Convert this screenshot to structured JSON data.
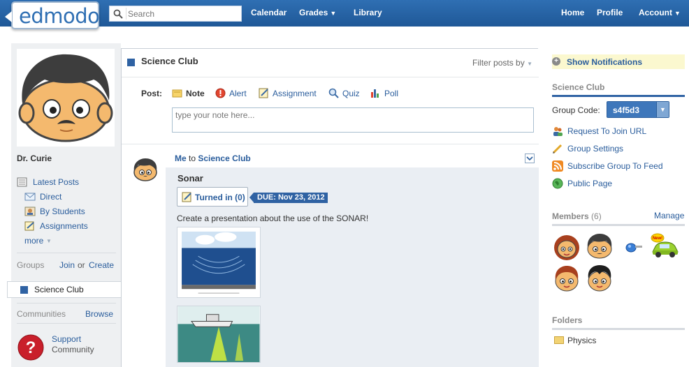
{
  "header": {
    "logo": "edmodo",
    "search_placeholder": "Search",
    "nav_left": [
      {
        "label": "Calendar",
        "has_caret": false
      },
      {
        "label": "Grades",
        "has_caret": true
      },
      {
        "label": "Library",
        "has_caret": false
      }
    ],
    "nav_right": [
      {
        "label": "Home",
        "has_caret": false
      },
      {
        "label": "Profile",
        "has_caret": false
      },
      {
        "label": "Account",
        "has_caret": true
      }
    ]
  },
  "sidebar": {
    "username": "Dr. Curie",
    "latest_posts": "Latest Posts",
    "items": [
      {
        "label": "Direct",
        "icon": "envelope-icon"
      },
      {
        "label": "By Students",
        "icon": "students-icon"
      },
      {
        "label": "Assignments",
        "icon": "assignment-icon"
      }
    ],
    "more": "more",
    "groups_label": "Groups",
    "join": "Join",
    "or": "or",
    "create": "Create",
    "active_group": "Science Club",
    "communities_label": "Communities",
    "browse": "Browse",
    "support_line1": "Support",
    "support_line2": "Community"
  },
  "main": {
    "group_title": "Science Club",
    "filter_label": "Filter posts by",
    "post_label": "Post:",
    "post_types": [
      {
        "label": "Note",
        "icon": "note-icon",
        "active": true
      },
      {
        "label": "Alert",
        "icon": "alert-icon",
        "active": false
      },
      {
        "label": "Assignment",
        "icon": "assignment-icon",
        "active": false
      },
      {
        "label": "Quiz",
        "icon": "quiz-icon",
        "active": false
      },
      {
        "label": "Poll",
        "icon": "poll-icon",
        "active": false
      }
    ],
    "note_placeholder": "type your note here...",
    "post": {
      "sender": "Me",
      "to_word": "to",
      "recipient": "Science Club",
      "title": "Sonar",
      "turned_in": "Turned in (0)",
      "due": "DUE: Nov 23, 2012",
      "body": "Create a presentation about the use of the SONAR!"
    }
  },
  "right": {
    "show_notifications": "Show Notifications",
    "group_heading": "Science Club",
    "group_code_label": "Group Code:",
    "group_code": "s4f5d3",
    "links": [
      {
        "label": "Request To Join URL",
        "icon": "users-icon"
      },
      {
        "label": "Group Settings",
        "icon": "pencil-icon"
      },
      {
        "label": "Subscribe Group To Feed",
        "icon": "rss-icon"
      },
      {
        "label": "Public Page",
        "icon": "globe-icon"
      }
    ],
    "members_label": "Members",
    "members_count": "(6)",
    "manage": "Manage",
    "new_badge": "New!",
    "folders_label": "Folders",
    "folder_name": "Physics"
  },
  "colors": {
    "topbar": "#2a66a9",
    "accent": "#2f62a3",
    "link": "#2a5d9c",
    "notification_bg": "#fbf8cf"
  }
}
